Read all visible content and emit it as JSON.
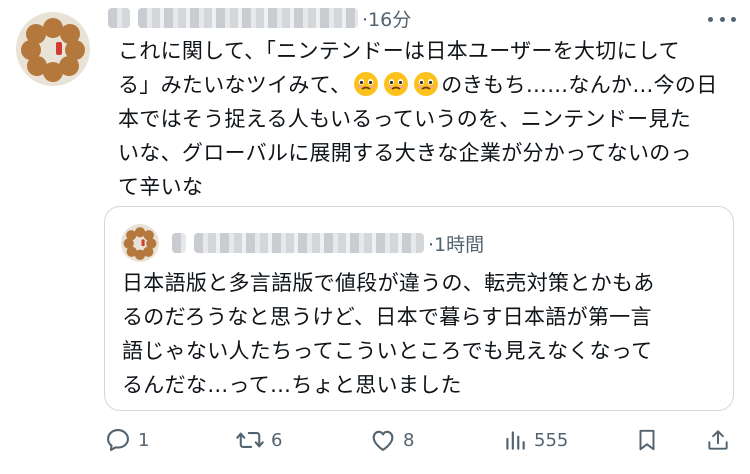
{
  "tweet": {
    "time": "·16分",
    "text_lines": [
      "これに関して、「ニンテンドーは日本ユーザーを大切にして",
      "る」みたいなツイみて、",
      "のきもち……なんか…今の日",
      "本ではそう捉える人もいるっていうのを、ニンテンドー見た",
      "いな、グローバルに展開する大きな企業が分かってないのっ",
      "て辛いな"
    ],
    "emoji": [
      "face-holding-back-tears-icon",
      "face-holding-back-tears-icon",
      "face-holding-back-tears-icon"
    ]
  },
  "quote": {
    "time": "·1時間",
    "text_lines": [
      "日本語版と多言語版で値段が違うの、転売対策とかもあ",
      "るのだろうなと思うけど、日本で暮らす日本語が第一言",
      "語じゃない人たちってこういところでも見えなくなって",
      "るんだな…って…ちょと思いました"
    ]
  },
  "actions": {
    "replies": "1",
    "retweets": "6",
    "likes": "8",
    "views": "555"
  },
  "colors": {
    "text": "#0f1419",
    "secondary": "#536471",
    "border": "#cfd9de"
  }
}
